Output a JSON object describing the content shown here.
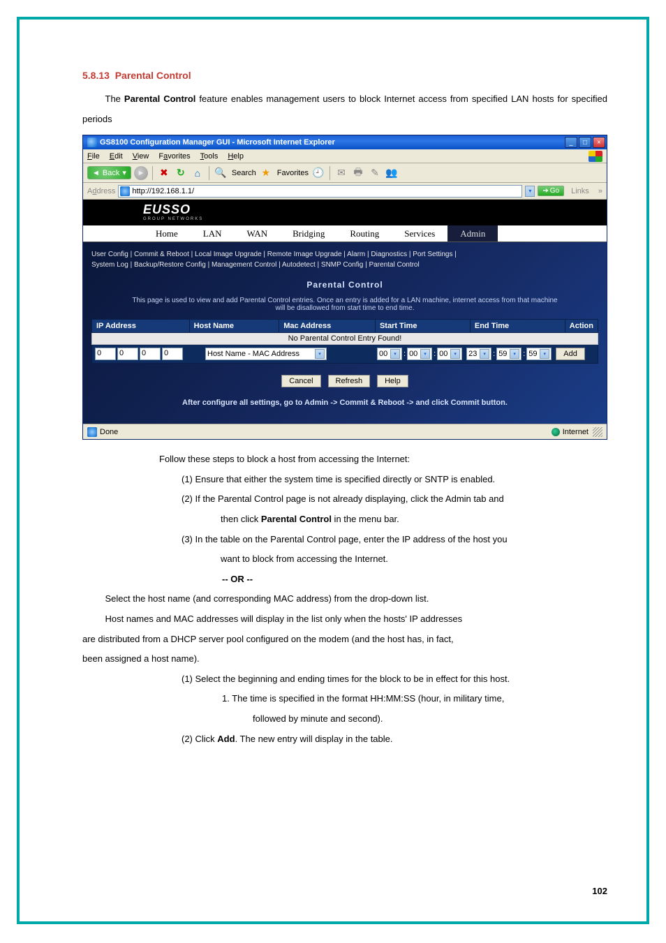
{
  "section": {
    "number": "5.8.13",
    "title": "Parental Control"
  },
  "intro": {
    "prefix": "The ",
    "feature": "Parental Control",
    "suffix": " feature enables management users to block Internet access from specified LAN hosts for specified periods"
  },
  "window": {
    "title": "GS8100 Configuration Manager GUI - Microsoft Internet Explorer",
    "menu": {
      "file": "File",
      "edit": "Edit",
      "view": "View",
      "favorites": "Favorites",
      "tools": "Tools",
      "help": "Help"
    },
    "toolbar": {
      "back": "Back",
      "search": "Search",
      "favorites": "Favorites"
    },
    "address": {
      "label": "Address",
      "url": "http://192.168.1.1/",
      "go": "Go",
      "links": "Links"
    },
    "brand": "EUSSO",
    "nav": [
      "Home",
      "LAN",
      "WAN",
      "Bridging",
      "Routing",
      "Services",
      "Admin"
    ],
    "subnav1": "User Config | Commit & Reboot | Local Image Upgrade | Remote Image Upgrade | Alarm | Diagnostics | Port Settings |",
    "subnav2": "System Log | Backup/Restore Config | Management Control | Autodetect | SNMP Config | Parental Control",
    "pc_title": "Parental Control",
    "pc_desc1": "This page is used to view and add Parental Control entries. Once an entry is added for a LAN machine, internet access from that machine",
    "pc_desc2": "will be disallowed from start time to end time.",
    "chart_data": {
      "type": "table",
      "columns": [
        "IP Address",
        "Host Name",
        "Mac Address",
        "Start Time",
        "End Time",
        "Action"
      ],
      "rows": [],
      "empty_message": "No Parental Control Entry Found!"
    },
    "entry": {
      "ip": [
        "0",
        "0",
        "0",
        "0"
      ],
      "host_placeholder": "Host Name - MAC Address",
      "start": [
        "00",
        "00",
        "00"
      ],
      "end": [
        "23",
        "59",
        "59"
      ],
      "add": "Add"
    },
    "buttons": {
      "cancel": "Cancel",
      "refresh": "Refresh",
      "help": "Help"
    },
    "tip": "After configure all settings, go to Admin -> Commit & Reboot -> and click Commit button.",
    "status": {
      "done": "Done",
      "zone": "Internet"
    }
  },
  "steps": {
    "lead": "Follow these steps to block a host from accessing the Internet:",
    "s1": "(1)  Ensure that either the system time is specified directly or SNTP is enabled.",
    "s2a": "(2)  If the Parental Control page is not already displaying, click the Admin tab and",
    "s2b_prefix": "then click ",
    "s2b_bold": "Parental Control",
    "s2b_suffix": " in the menu bar.",
    "s3a": "(3)  In the table on the Parental Control page, enter the IP address of the host you",
    "s3b": "want to block from accessing the Internet.",
    "or": "-- OR --",
    "alt": "Select the host name (and corresponding MAC address) from the drop-down list.",
    "note1": "Host names and MAC addresses will display in the list only when the hosts' IP addresses",
    "note2": "are distributed from a DHCP server pool configured on the modem (and the host has, in fact,",
    "note3": "been assigned a host name).",
    "s4": "(1)  Select the beginning and ending times for the block to be in effect for this host.",
    "s4sub1": "1.   The time is specified in the format HH:MM:SS (hour, in military time,",
    "s4sub2": "followed by minute and second).",
    "s5_prefix": "(2)  Click ",
    "s5_bold": "Add",
    "s5_suffix": ". The new entry will display in the table."
  },
  "page_number": "102"
}
